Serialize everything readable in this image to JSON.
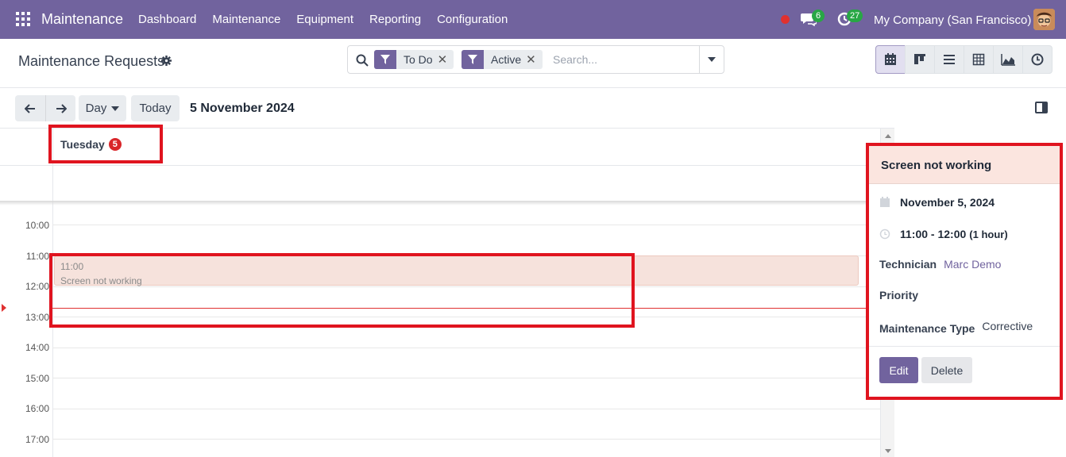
{
  "navbar": {
    "app_name": "Maintenance",
    "menu": [
      "Dashboard",
      "Maintenance",
      "Equipment",
      "Reporting",
      "Configuration"
    ],
    "messages_count": "6",
    "activities_count": "27",
    "company": "My Company (San Francisco)",
    "accent_color": "#71639e"
  },
  "control_panel": {
    "title": "Maintenance Requests",
    "facets": [
      "To Do",
      "Active"
    ],
    "search_placeholder": "Search...",
    "views": [
      "calendar-icon",
      "kanban-icon",
      "list-icon",
      "pivot-icon",
      "graph-icon",
      "activity-icon"
    ]
  },
  "calendar_toolbar": {
    "scale": "Day",
    "today": "Today",
    "date": "5 November 2024"
  },
  "calendar": {
    "day_label": "Tuesday",
    "day_count": "5",
    "hours": [
      "10:00",
      "11:00",
      "12:00",
      "13:00",
      "14:00",
      "15:00",
      "16:00",
      "17:00"
    ],
    "event": {
      "time": "11:00",
      "title": "Screen not working"
    }
  },
  "popover": {
    "title": "Screen not working",
    "date": "November 5, 2024",
    "time": "11:00 - 12:00",
    "duration": "(1 hour)",
    "technician_label": "Technician",
    "technician": "Marc Demo",
    "priority_label": "Priority",
    "type_label": "Maintenance Type",
    "type": "Corrective",
    "edit": "Edit",
    "delete": "Delete"
  }
}
